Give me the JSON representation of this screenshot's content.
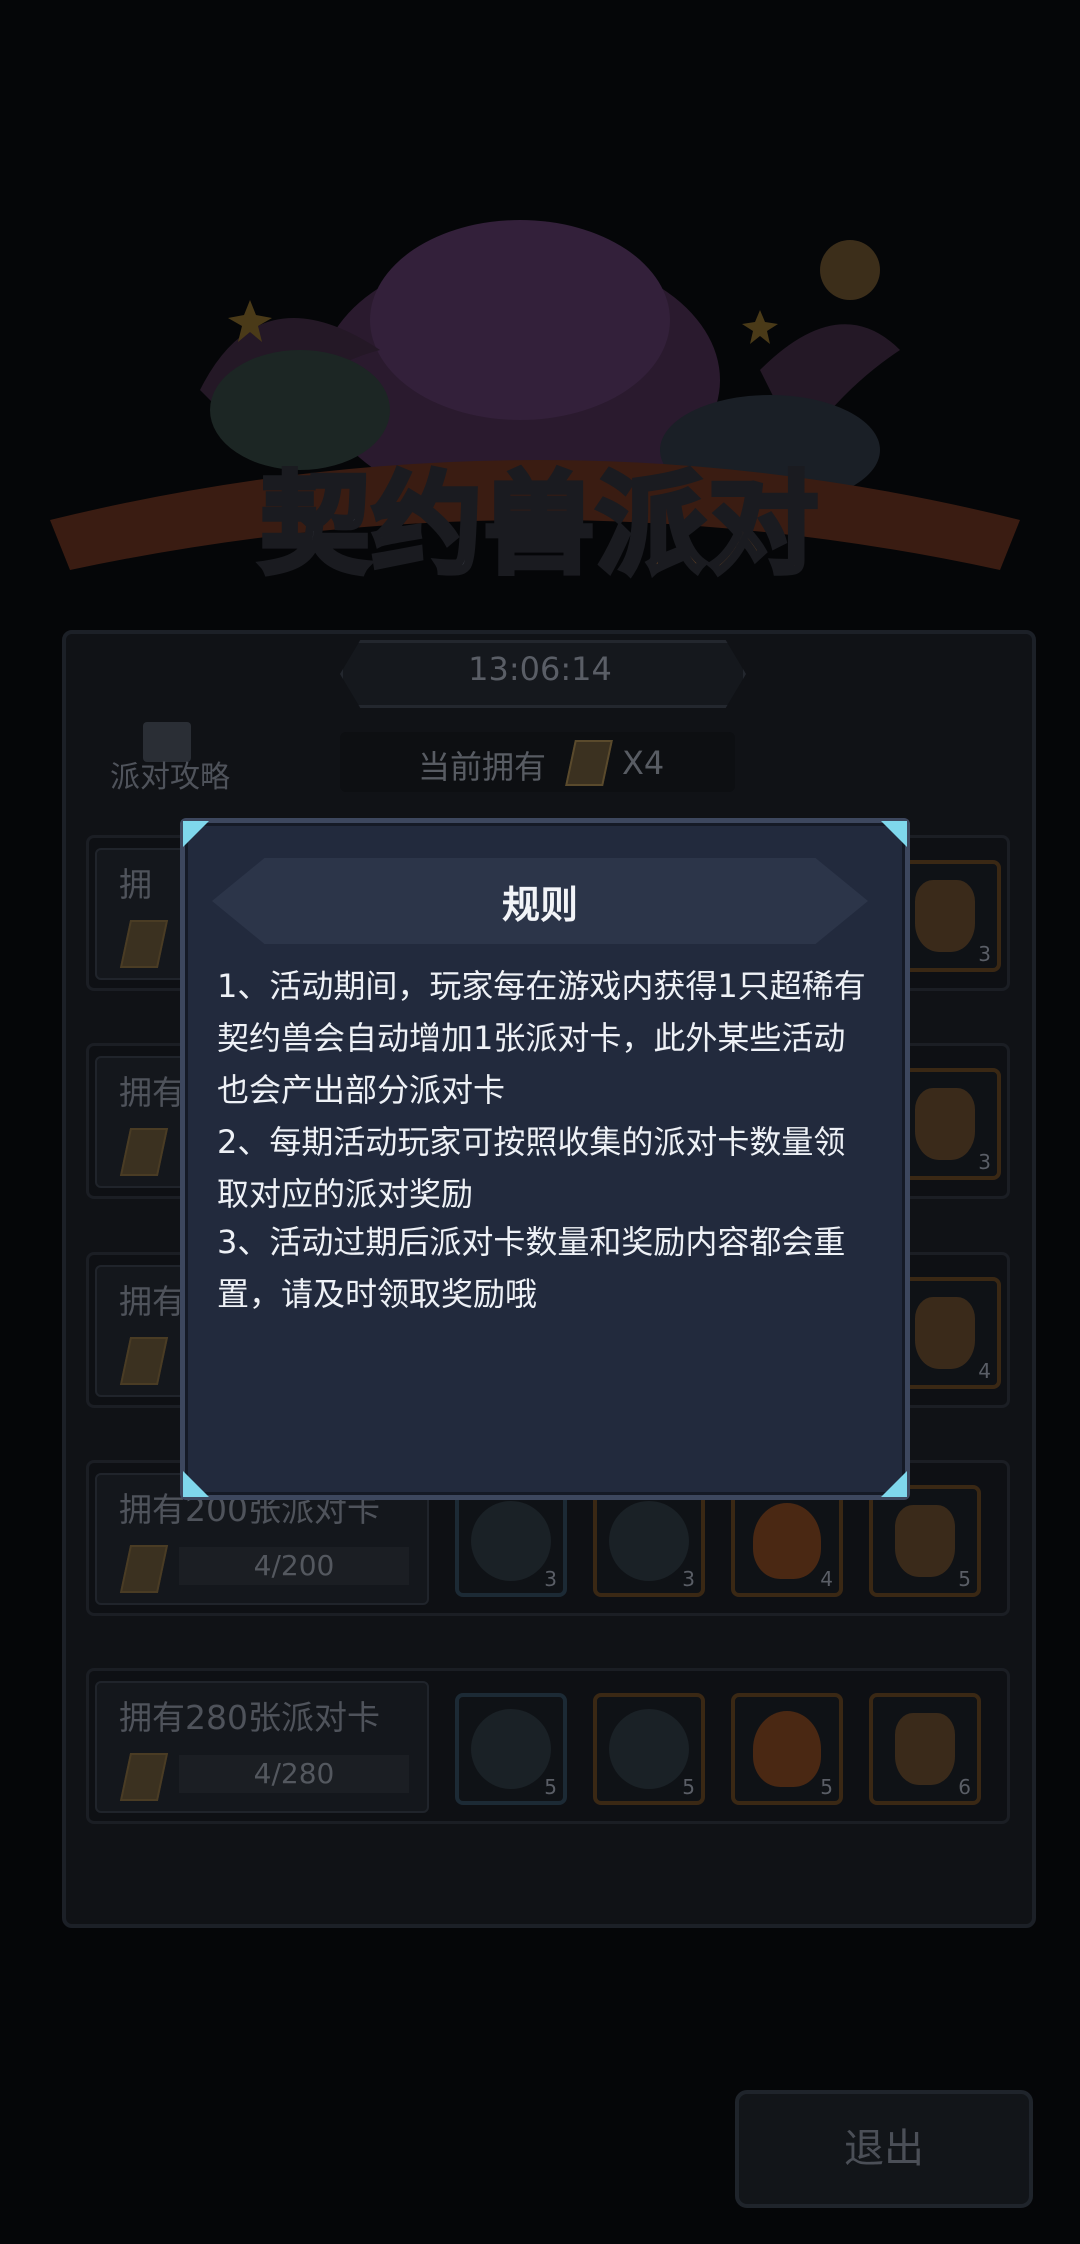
{
  "event": {
    "title_part1": "契约兽",
    "title_part2": "派对",
    "timer": "13:06:14",
    "guide_label": "派对攻略",
    "owned_label": "当前拥有",
    "owned_count": "X4"
  },
  "rows": [
    {
      "title": "拥有200张派对卡",
      "progress": "4/200",
      "rewards": [
        "3",
        "3",
        "4",
        "5"
      ]
    },
    {
      "title": "拥有280张派对卡",
      "progress": "4/280",
      "rewards": [
        "5",
        "5",
        "5",
        "6"
      ]
    }
  ],
  "hidden_rows_partial": [
    {
      "title": "拥",
      "reward_last": "3"
    },
    {
      "title": "拥有",
      "reward_last": "3"
    },
    {
      "title": "拥有",
      "reward_last": "4"
    }
  ],
  "modal": {
    "title": "规则",
    "rules": [
      "1、活动期间，玩家每在游戏内获得1只超稀有契约兽会自动增加1张派对卡，此外某些活动也会产出部分派对卡",
      "2、每期活动玩家可按照收集的派对卡数量领取对应的派对奖励",
      "3、活动过期后派对卡数量和奖励内容都会重置，请及时领取奖励哦"
    ]
  },
  "exit_label": "退出"
}
